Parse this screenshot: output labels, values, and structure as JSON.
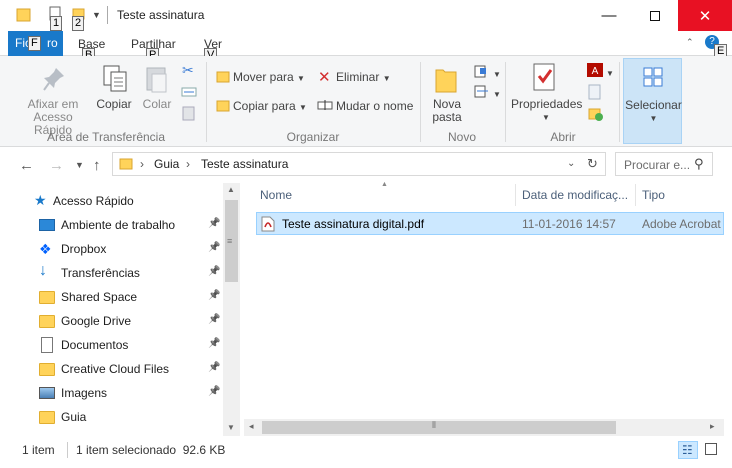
{
  "window": {
    "title": "Teste assinatura"
  },
  "keytips": {
    "qat1": "1",
    "qat2": "2",
    "file": "F",
    "base": "B",
    "share": "P",
    "view": "V",
    "help": "E"
  },
  "tabs": {
    "file": "Ficheiro",
    "file_visible": "Fic",
    "file_visible2": "ro",
    "base": "Base",
    "share": "Partilhar",
    "view": "Ver"
  },
  "ribbon": {
    "clipboard": {
      "pin_label": "Afixar em Acesso Rápido",
      "pin_line1": "Afixar em",
      "pin_line2": "Acesso Rápido",
      "copy": "Copiar",
      "paste": "Colar",
      "group": "Área de Transferência"
    },
    "organize": {
      "move_to": "Mover para",
      "copy_to": "Copiar para",
      "delete": "Eliminar",
      "rename": "Mudar o nome",
      "group": "Organizar"
    },
    "new": {
      "new_folder_line1": "Nova",
      "new_folder_line2": "pasta",
      "group": "Novo"
    },
    "open": {
      "properties": "Propriedades",
      "group": "Abrir"
    },
    "select": {
      "select": "Selecionar"
    }
  },
  "address": {
    "crumb1": "Guia",
    "crumb2": "Teste assinatura",
    "search_placeholder": "Procurar e..."
  },
  "nav": {
    "header": "Acesso Rápido",
    "items": [
      {
        "label": "Ambiente de trabalho",
        "icon": "desktop-icon",
        "pinned": true
      },
      {
        "label": "Dropbox",
        "icon": "dropbox-icon",
        "pinned": true
      },
      {
        "label": "Transferências",
        "icon": "download-icon",
        "pinned": true
      },
      {
        "label": "Shared Space",
        "icon": "folder-icon",
        "pinned": true
      },
      {
        "label": "Google Drive",
        "icon": "folder-icon",
        "pinned": true
      },
      {
        "label": "Documentos",
        "icon": "documents-icon",
        "pinned": true
      },
      {
        "label": "Creative Cloud Files",
        "icon": "folder-icon",
        "pinned": true
      },
      {
        "label": "Imagens",
        "icon": "pictures-icon",
        "pinned": true
      },
      {
        "label": "Guia",
        "icon": "folder-icon",
        "pinned": false
      }
    ]
  },
  "columns": {
    "name": "Nome",
    "date": "Data de modificaç...",
    "type": "Tipo"
  },
  "files": [
    {
      "name": "Teste assinatura digital.pdf",
      "date": "11-01-2016 14:57",
      "type": "Adobe Acrobat"
    }
  ],
  "status": {
    "count": "1 item",
    "selected": "1 item selecionado  92.6 KB"
  },
  "colors": {
    "accent": "#1979ca",
    "selection": "#cce8ff",
    "close": "#e81123"
  }
}
